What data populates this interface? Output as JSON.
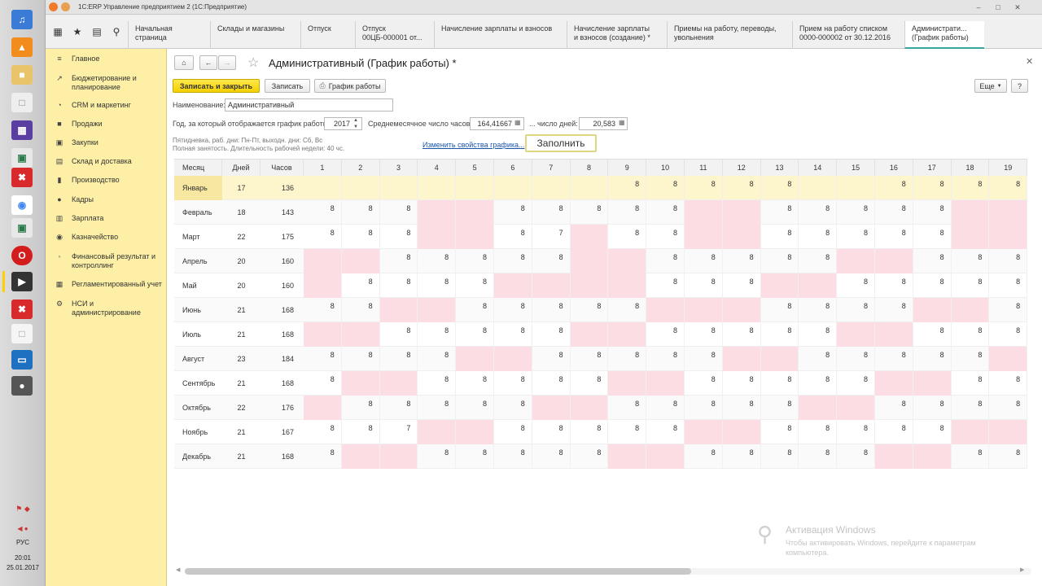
{
  "window": {
    "title": "1С:ERP Управление предприятием 2  (1С:Предприятие)"
  },
  "tabs": [
    {
      "label": "Начальная страница"
    },
    {
      "label": "Склады и магазины"
    },
    {
      "label": "Отпуск"
    },
    {
      "label": "Отпуск\n00ЦБ-000001 от..."
    },
    {
      "label": "Начисление зарплаты и взносов"
    },
    {
      "label": "Начисление зарплаты\nи взносов (создание) *"
    },
    {
      "label": "Приемы на работу, переводы,\nувольнения"
    },
    {
      "label": "Прием на работу списком\n0000-000002 от 30.12.2016"
    },
    {
      "label": "Администрати...\n(График работы)"
    }
  ],
  "sidebar": {
    "items": [
      {
        "label": "Главное",
        "icon": "menu-icon"
      },
      {
        "label": "Бюджетирование и\nпланирование",
        "icon": "chart-icon"
      },
      {
        "label": "CRM и маркетинг",
        "icon": "pie-icon"
      },
      {
        "label": "Продажи",
        "icon": "bag-icon"
      },
      {
        "label": "Закупки",
        "icon": "cart-icon"
      },
      {
        "label": "Склад и доставка",
        "icon": "box-icon"
      },
      {
        "label": "Производство",
        "icon": "factory-icon"
      },
      {
        "label": "Кадры",
        "icon": "person-icon"
      },
      {
        "label": "Зарплата",
        "icon": "wallet-icon"
      },
      {
        "label": "Казначейство",
        "icon": "coin-icon"
      },
      {
        "label": "Финансовый результат и\nконтроллинг",
        "icon": "finance-icon"
      },
      {
        "label": "Регламентированный учет",
        "icon": "book-icon"
      },
      {
        "label": "НСИ и\nадминистрирование",
        "icon": "gear-icon"
      }
    ]
  },
  "form": {
    "title": "Административный (График работы) *",
    "save_close_label": "Записать и закрыть",
    "save_label": "Записать",
    "schedule_label": "График работы",
    "more_label": "Еще",
    "help_label": "?",
    "name_label": "Наименование:",
    "name_value": "Административный",
    "year_label": "Год, за который отображается график работы:",
    "year_value": "2017",
    "avg_hours_label": "Среднемесячное число часов:",
    "avg_hours_value": "164,41667",
    "days_label": "... число дней:",
    "days_value": "20,583",
    "info_line1": "Пятидневка, раб. дни: Пн-Пт, выходн. дни: Сб, Вс",
    "info_line2": "Полная занятость. Длительность рабочей недели: 40 чс.",
    "change_link": "Изменить свойства графика...",
    "fill_label": "Заполнить"
  },
  "grid": {
    "headers": [
      "Месяц",
      "Дней",
      "Часов"
    ],
    "day_headers": [
      "1",
      "2",
      "3",
      "4",
      "5",
      "6",
      "7",
      "8",
      "9",
      "10",
      "11",
      "12",
      "13",
      "14",
      "15",
      "16",
      "17",
      "18",
      "19"
    ],
    "rows": [
      {
        "month": "Январь",
        "days": "17",
        "hours": "136",
        "cells": [
          "",
          "",
          "",
          "",
          "",
          "",
          "",
          "",
          "8",
          "8",
          "8",
          "8",
          "8",
          "",
          "",
          "8",
          "8",
          "8",
          "8"
        ],
        "off": []
      },
      {
        "month": "Февраль",
        "days": "18",
        "hours": "143",
        "cells": [
          "8",
          "8",
          "8",
          "",
          "",
          "8",
          "8",
          "8",
          "8",
          "8",
          "",
          "",
          "8",
          "8",
          "8",
          "8",
          "8",
          "",
          ""
        ],
        "off": [
          4,
          5,
          11,
          12,
          18,
          19
        ]
      },
      {
        "month": "Март",
        "days": "22",
        "hours": "175",
        "cells": [
          "8",
          "8",
          "8",
          "",
          "",
          "8",
          "7",
          "",
          "8",
          "8",
          "",
          "",
          "8",
          "8",
          "8",
          "8",
          "8",
          "",
          ""
        ],
        "off": [
          4,
          5,
          8,
          11,
          12,
          18,
          19
        ]
      },
      {
        "month": "Апрель",
        "days": "20",
        "hours": "160",
        "cells": [
          "",
          "",
          "8",
          "8",
          "8",
          "8",
          "8",
          "",
          "",
          "8",
          "8",
          "8",
          "8",
          "8",
          "",
          "",
          "8",
          "8",
          "8"
        ],
        "off": [
          1,
          2,
          8,
          9,
          15,
          16
        ]
      },
      {
        "month": "Май",
        "days": "20",
        "hours": "160",
        "cells": [
          "",
          "8",
          "8",
          "8",
          "8",
          "",
          "",
          "",
          "",
          "8",
          "8",
          "8",
          "",
          "",
          "8",
          "8",
          "8",
          "8",
          "8"
        ],
        "off": [
          1,
          6,
          7,
          8,
          9,
          13,
          14
        ]
      },
      {
        "month": "Июнь",
        "days": "21",
        "hours": "168",
        "cells": [
          "8",
          "8",
          "",
          "",
          "8",
          "8",
          "8",
          "8",
          "8",
          "",
          "",
          "",
          "8",
          "8",
          "8",
          "8",
          "",
          "",
          "8"
        ],
        "off": [
          3,
          4,
          10,
          11,
          12,
          17,
          18
        ]
      },
      {
        "month": "Июль",
        "days": "21",
        "hours": "168",
        "cells": [
          "",
          "",
          "8",
          "8",
          "8",
          "8",
          "8",
          "",
          "",
          "8",
          "8",
          "8",
          "8",
          "8",
          "",
          "",
          "8",
          "8",
          "8"
        ],
        "off": [
          1,
          2,
          8,
          9,
          15,
          16
        ]
      },
      {
        "month": "Август",
        "days": "23",
        "hours": "184",
        "cells": [
          "8",
          "8",
          "8",
          "8",
          "",
          "",
          "8",
          "8",
          "8",
          "8",
          "8",
          "",
          "",
          "8",
          "8",
          "8",
          "8",
          "8",
          ""
        ],
        "off": [
          5,
          6,
          12,
          13,
          19
        ]
      },
      {
        "month": "Сентябрь",
        "days": "21",
        "hours": "168",
        "cells": [
          "8",
          "",
          "",
          "8",
          "8",
          "8",
          "8",
          "8",
          "",
          "",
          "8",
          "8",
          "8",
          "8",
          "8",
          "",
          "",
          "8",
          "8"
        ],
        "off": [
          2,
          3,
          9,
          10,
          16,
          17
        ]
      },
      {
        "month": "Октябрь",
        "days": "22",
        "hours": "176",
        "cells": [
          "",
          "8",
          "8",
          "8",
          "8",
          "8",
          "",
          "",
          "8",
          "8",
          "8",
          "8",
          "8",
          "",
          "",
          "8",
          "8",
          "8",
          "8"
        ],
        "off": [
          1,
          7,
          8,
          14,
          15
        ]
      },
      {
        "month": "Ноябрь",
        "days": "21",
        "hours": "167",
        "cells": [
          "8",
          "8",
          "7",
          "",
          "",
          "8",
          "8",
          "8",
          "8",
          "8",
          "",
          "",
          "8",
          "8",
          "8",
          "8",
          "8",
          "",
          ""
        ],
        "off": [
          4,
          5,
          11,
          12,
          18,
          19
        ]
      },
      {
        "month": "Декабрь",
        "days": "21",
        "hours": "168",
        "cells": [
          "8",
          "",
          "",
          "8",
          "8",
          "8",
          "8",
          "8",
          "",
          "",
          "8",
          "8",
          "8",
          "8",
          "8",
          "",
          "",
          "8",
          "8"
        ],
        "off": [
          2,
          3,
          9,
          10,
          16,
          17
        ]
      }
    ]
  },
  "activation": {
    "title": "Активация Windows",
    "text1": "Чтобы активировать Windows, перейдите к параметрам",
    "text2": "компьютера."
  },
  "tray": {
    "lang": "РУС",
    "time": "20:01",
    "date": "25.01.2017"
  },
  "colors": {
    "accent": "#f3cf00",
    "sidebar": "#fdf0a6",
    "weekend": "#fcdde3",
    "selected_row": "#fdf5cc"
  }
}
